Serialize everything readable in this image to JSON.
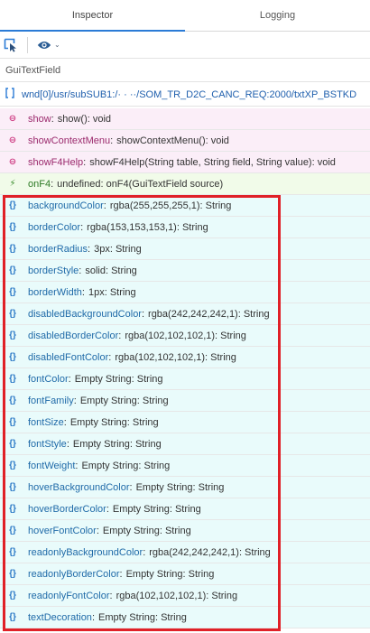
{
  "tabs": [
    {
      "label": "Inspector",
      "active": true
    },
    {
      "label": "Logging",
      "active": false
    }
  ],
  "toolbar": {
    "select_icon": "select-element-icon",
    "view_icon": "eye-icon",
    "dropdown_icon": "chevron-down-icon"
  },
  "section_title": "GuiTextField",
  "path": "wnd[0]/usr/subSUB1:/·  ·  ··/SOM_TR_D2C_CANC_REQ:2000/txtXP_BSTKD",
  "methods": [
    {
      "icon": "⊖",
      "name": "show",
      "signature": "show():  void"
    },
    {
      "icon": "⊖",
      "name": "showContextMenu",
      "signature": "showContextMenu():  void"
    },
    {
      "icon": "⊖",
      "name": "showF4Help",
      "signature": "showF4Help(String table, String field, String value):  void"
    }
  ],
  "events": [
    {
      "icon": "⚡",
      "name": "onF4",
      "signature": "undefined:  onF4(GuiTextField source)"
    }
  ],
  "properties": [
    {
      "icon": "{}",
      "name": "backgroundColor",
      "signature": "rgba(255,255,255,1):  String"
    },
    {
      "icon": "{}",
      "name": "borderColor",
      "signature": "rgba(153,153,153,1):  String"
    },
    {
      "icon": "{}",
      "name": "borderRadius",
      "signature": "3px:  String"
    },
    {
      "icon": "{}",
      "name": "borderStyle",
      "signature": "solid:  String"
    },
    {
      "icon": "{}",
      "name": "borderWidth",
      "signature": "1px:  String"
    },
    {
      "icon": "{}",
      "name": "disabledBackgroundColor",
      "signature": "rgba(242,242,242,1):  String"
    },
    {
      "icon": "{}",
      "name": "disabledBorderColor",
      "signature": "rgba(102,102,102,1):  String"
    },
    {
      "icon": "{}",
      "name": "disabledFontColor",
      "signature": "rgba(102,102,102,1):  String"
    },
    {
      "icon": "{}",
      "name": "fontColor",
      "signature": "Empty String:  String"
    },
    {
      "icon": "{}",
      "name": "fontFamily",
      "signature": "Empty String:  String"
    },
    {
      "icon": "{}",
      "name": "fontSize",
      "signature": "Empty String:  String"
    },
    {
      "icon": "{}",
      "name": "fontStyle",
      "signature": "Empty String:  String"
    },
    {
      "icon": "{}",
      "name": "fontWeight",
      "signature": "Empty String:  String"
    },
    {
      "icon": "{}",
      "name": "hoverBackgroundColor",
      "signature": "Empty String:  String"
    },
    {
      "icon": "{}",
      "name": "hoverBorderColor",
      "signature": "Empty String:  String"
    },
    {
      "icon": "{}",
      "name": "hoverFontColor",
      "signature": "Empty String:  String"
    },
    {
      "icon": "{}",
      "name": "readonlyBackgroundColor",
      "signature": "rgba(242,242,242,1):  String"
    },
    {
      "icon": "{}",
      "name": "readonlyBorderColor",
      "signature": "Empty String:  String"
    },
    {
      "icon": "{}",
      "name": "readonlyFontColor",
      "signature": "rgba(102,102,102,1):  String"
    },
    {
      "icon": "{}",
      "name": "textDecoration",
      "signature": "Empty String:  String"
    }
  ],
  "colors": {
    "accent": "#2b7bd6",
    "highlight_border": "#e02027",
    "method_bg": "#fbeef8",
    "event_bg": "#f1fbe9",
    "property_bg": "#e9fbfb"
  }
}
